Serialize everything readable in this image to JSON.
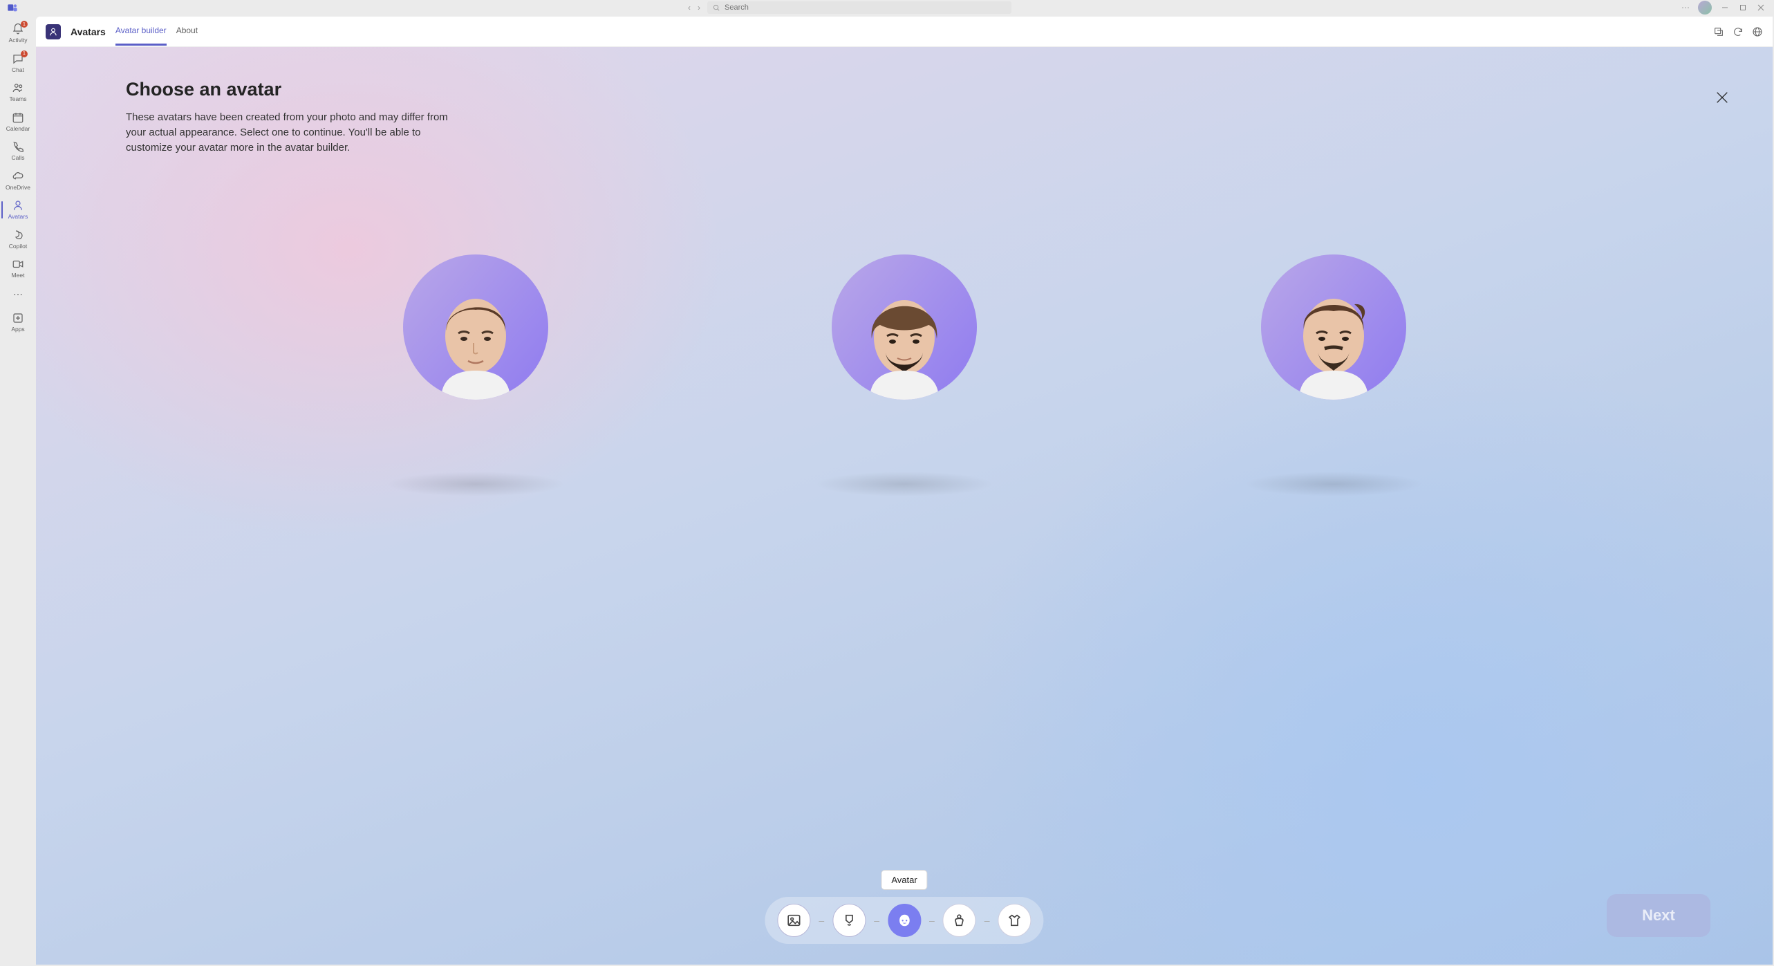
{
  "titlebar": {
    "search_placeholder": "Search"
  },
  "rail": {
    "items": [
      {
        "label": "Activity",
        "badge": "1"
      },
      {
        "label": "Chat",
        "badge": "1"
      },
      {
        "label": "Teams"
      },
      {
        "label": "Calendar"
      },
      {
        "label": "Calls"
      },
      {
        "label": "OneDrive"
      },
      {
        "label": "Avatars",
        "active": true
      },
      {
        "label": "Copilot"
      },
      {
        "label": "Meet"
      }
    ],
    "apps_label": "Apps"
  },
  "header": {
    "app_name": "Avatars",
    "tabs": [
      {
        "label": "Avatar builder",
        "selected": true
      },
      {
        "label": "About",
        "selected": false
      }
    ]
  },
  "page": {
    "title": "Choose an avatar",
    "description": "These avatars have been created from your photo and may differ from your actual appearance. Select one to continue. You'll be able to customize your avatar more in the avatar builder."
  },
  "stepper": {
    "tooltip": "Avatar",
    "steps": [
      {
        "name": "photo",
        "state": "done"
      },
      {
        "name": "style",
        "state": "done"
      },
      {
        "name": "avatar",
        "state": "current"
      },
      {
        "name": "body",
        "state": "upcoming"
      },
      {
        "name": "outfit",
        "state": "upcoming"
      }
    ]
  },
  "next_button_label": "Next"
}
